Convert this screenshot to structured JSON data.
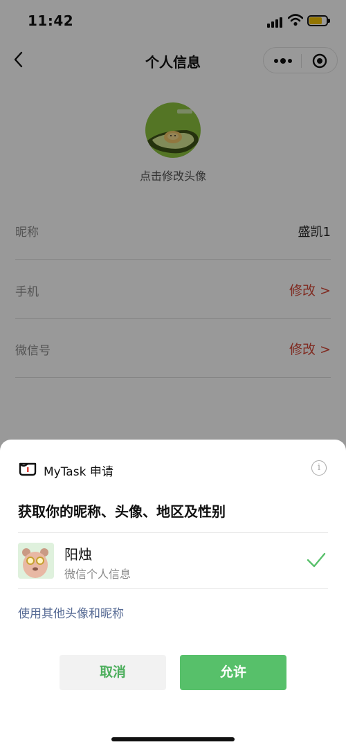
{
  "status_bar": {
    "time": "11:42",
    "icons": [
      "signal-icon",
      "wifi-icon",
      "battery-icon"
    ]
  },
  "nav": {
    "title": "个人信息",
    "back_icon": "chevron-left-icon",
    "capsule_icons": [
      "more-dots-icon",
      "target-icon"
    ]
  },
  "profile": {
    "avatar_icon": "avocado-avatar",
    "avatar_hint": "点击修改头像",
    "rows": [
      {
        "label": "昵称",
        "value": "盛凯1"
      },
      {
        "label": "手机",
        "action": "修改 >"
      },
      {
        "label": "微信号",
        "action": "修改 >"
      }
    ]
  },
  "auth_sheet": {
    "app_name": "MyTask 申请",
    "app_logo_icon": "mytask-logo-icon",
    "info_icon": "info-icon",
    "info_glyph": "i",
    "request": "获取你的昵称、头像、地区及性别",
    "account": {
      "name": "阳烛",
      "subtitle": "微信个人信息",
      "avatar_icon": "bear-avatar",
      "selected_icon": "check-icon"
    },
    "other_link": "使用其他头像和昵称",
    "cancel_label": "取消",
    "allow_label": "允许"
  },
  "colors": {
    "accent_green": "#57c06a",
    "link_blue": "#576b95",
    "action_red": "#d64a3a"
  }
}
